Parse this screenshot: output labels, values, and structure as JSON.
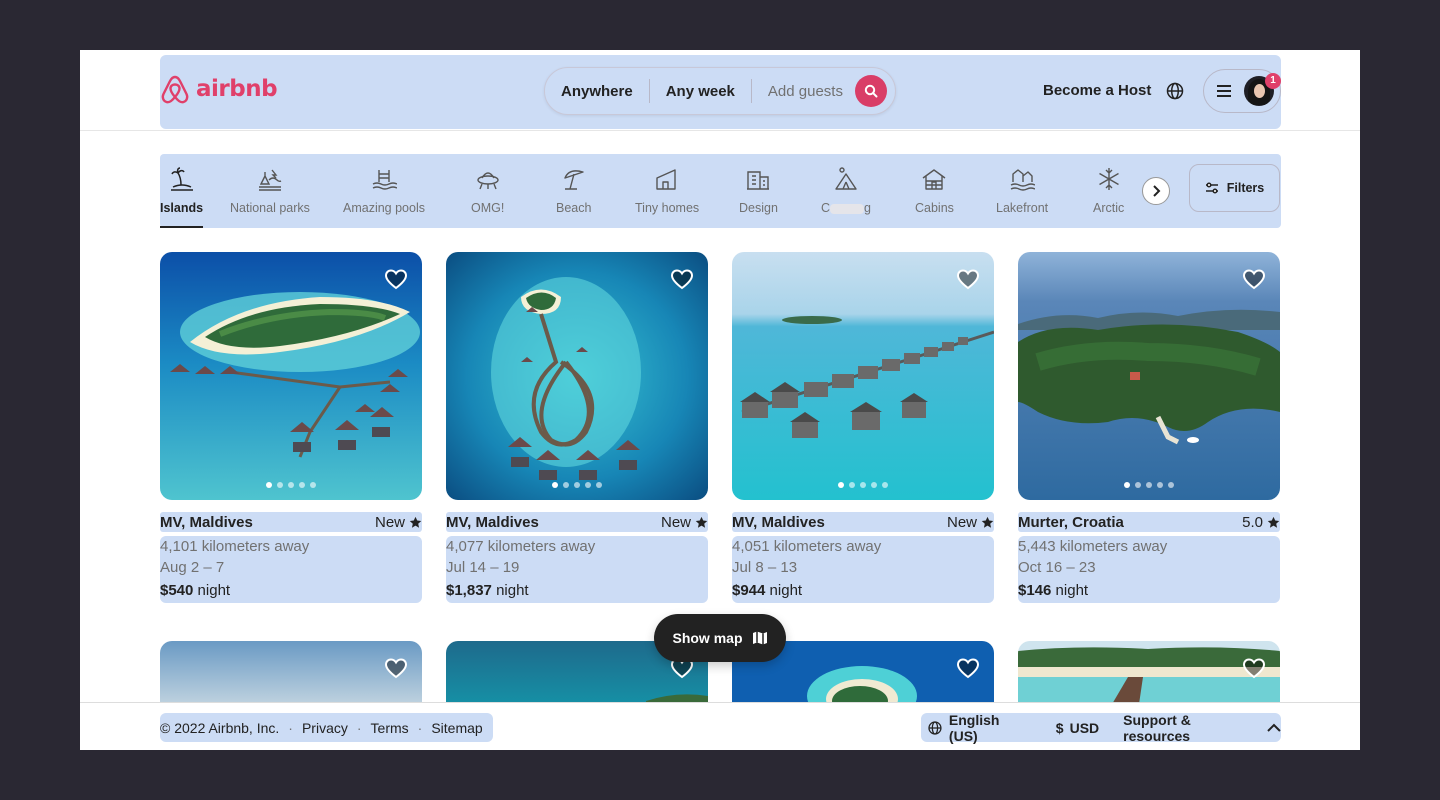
{
  "header": {
    "logo_text": "airbnb",
    "search": {
      "where": "Anywhere",
      "when": "Any week",
      "guests": "Add guests"
    },
    "become_host": "Become a Host",
    "notification_count": "1"
  },
  "categories": [
    {
      "label": "Islands",
      "icon": "island-icon",
      "active": true
    },
    {
      "label": "National parks",
      "icon": "national-park-icon"
    },
    {
      "label": "Amazing pools",
      "icon": "pool-icon"
    },
    {
      "label": "OMG!",
      "icon": "ufo-icon"
    },
    {
      "label": "Beach",
      "icon": "beach-umbrella-icon"
    },
    {
      "label": "Tiny homes",
      "icon": "tiny-home-icon"
    },
    {
      "label": "Design",
      "icon": "design-building-icon"
    },
    {
      "label": "C",
      "label_end": "g",
      "icon": "camping-icon"
    },
    {
      "label": "Cabins",
      "icon": "cabin-icon"
    },
    {
      "label": "Lakefront",
      "icon": "lakefront-icon"
    },
    {
      "label": "Arctic",
      "icon": "snowflake-icon"
    }
  ],
  "filters_label": "Filters",
  "listings": [
    {
      "place": "MV, Maldives",
      "rating": "New",
      "distance": "4,101 kilometers away",
      "dates": "Aug 2 – 7",
      "price": "$540",
      "per": "night"
    },
    {
      "place": "MV, Maldives",
      "rating": "New",
      "distance": "4,077 kilometers away",
      "dates": "Jul 14 – 19",
      "price": "$1,837",
      "per": "night"
    },
    {
      "place": "MV, Maldives",
      "rating": "New",
      "distance": "4,051 kilometers away",
      "dates": "Jul 8 – 13",
      "price": "$944",
      "per": "night"
    },
    {
      "place": "Murter, Croatia",
      "rating": "5.0",
      "distance": "5,443 kilometers away",
      "dates": "Oct 16 – 23",
      "price": "$146",
      "per": "night"
    }
  ],
  "show_map_label": "Show map",
  "footer": {
    "copyright": "© 2022 Airbnb, Inc.",
    "privacy": "Privacy",
    "terms": "Terms",
    "sitemap": "Sitemap",
    "language": "English (US)",
    "currency_symbol": "$",
    "currency": "USD",
    "support": "Support & resources"
  },
  "colors": {
    "brand": "#e0406a",
    "highlight": "#ccdcf5"
  }
}
